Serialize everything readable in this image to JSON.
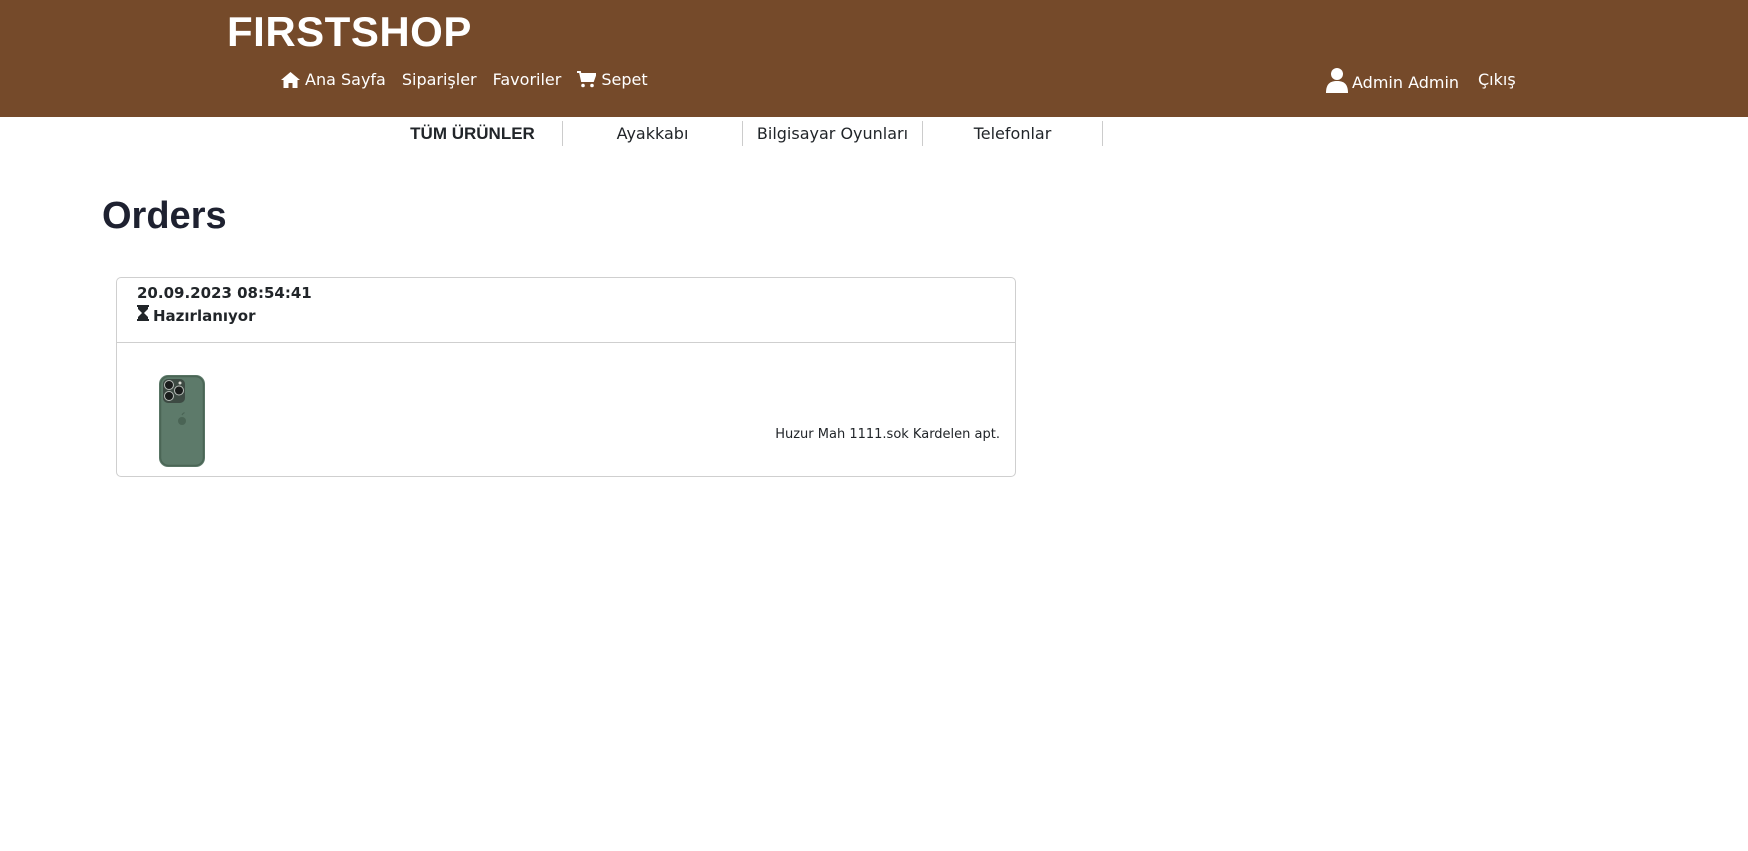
{
  "header": {
    "brand": "FIRSTSHOP",
    "nav": [
      {
        "label": "Ana Sayfa",
        "icon": "home-icon"
      },
      {
        "label": "Siparişler"
      },
      {
        "label": "Favoriler"
      },
      {
        "label": "Sepet",
        "icon": "cart-icon"
      }
    ],
    "user": {
      "label": "Admin Admin",
      "icon": "user-icon"
    },
    "logout": "Çıkış"
  },
  "categories": [
    {
      "label": "TÜM ÜRÜNLER",
      "active": true
    },
    {
      "label": "Ayakkabı"
    },
    {
      "label": "Bilgisayar Oyunları"
    },
    {
      "label": "Telefonlar"
    }
  ],
  "page": {
    "title": "Orders"
  },
  "orders": [
    {
      "date": "20.09.2023 08:54:41",
      "status": "Hazırlanıyor",
      "status_icon": "hourglass-icon",
      "product_image": "phone-case-image",
      "address": "Huzur Mah 1111.sok Kardelen apt."
    }
  ],
  "colors": {
    "header_bg": "#754a2a",
    "header_text": "#ffffff",
    "product_green": "#5d7a6a"
  }
}
